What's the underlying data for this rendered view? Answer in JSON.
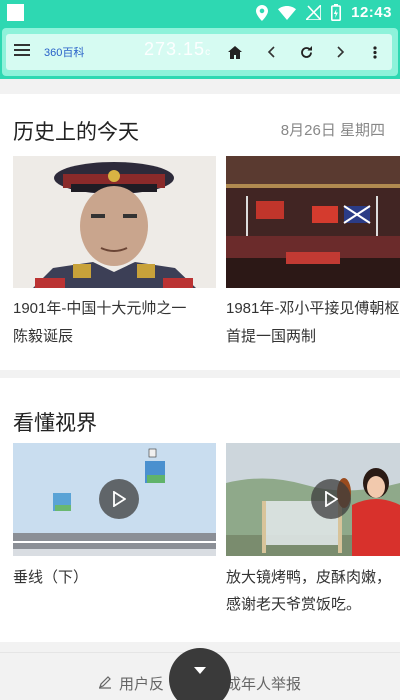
{
  "status_bar": {
    "time": "12:43"
  },
  "toolbar": {
    "title": "360百科",
    "score": "273.15",
    "score_unit": "c"
  },
  "history": {
    "title": "历史上的今天",
    "date": "8月26日 星期四",
    "items": [
      {
        "line1": "1901年-中国十大元帅之一",
        "line2": "陈毅诞辰"
      },
      {
        "line1": "1981年-邓小平接见傅朝枢",
        "line2": "首提一国两制"
      }
    ]
  },
  "videos": {
    "title": "看懂视界",
    "items": [
      {
        "line1": "垂线（下）",
        "line2": ""
      },
      {
        "line1": "放大镜烤鸭，皮酥肉嫩，",
        "line2": "感谢老天爷赏饭吃。"
      }
    ]
  },
  "footer": {
    "feedback": "用户反",
    "report": "成年人举报"
  },
  "colors": {
    "accent": "#2ed8b2",
    "toolbar_bg": "#d6fbf2",
    "title_link": "#2860c8"
  }
}
